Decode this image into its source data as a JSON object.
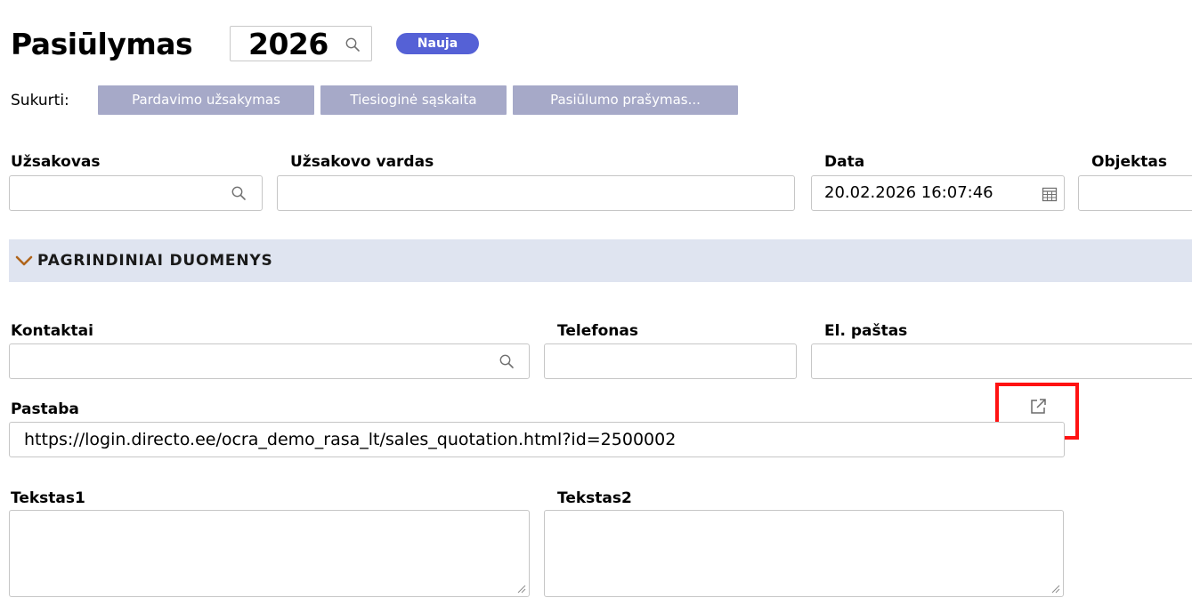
{
  "header": {
    "title": "Pasiūlymas",
    "number": "2026",
    "status": "Nauja"
  },
  "create": {
    "label": "Sukurti:",
    "buttons": [
      "Pardavimo užsakymas",
      "Tiesioginė sąskaita",
      "Pasiūlumo prašymas..."
    ]
  },
  "fields": {
    "customer_label": "Užsakovas",
    "customer_value": "",
    "customer_name_label": "Užsakovo vardas",
    "customer_name_value": "",
    "date_label": "Data",
    "date_value": "20.02.2026 16:07:46",
    "object_label": "Objektas",
    "object_value": ""
  },
  "section": {
    "title": "PAGRINDINIAI DUOMENYS"
  },
  "main": {
    "contacts_label": "Kontaktai",
    "contacts_value": "",
    "phone_label": "Telefonas",
    "phone_value": "",
    "email_label": "El. paštas",
    "email_value": "",
    "note_label": "Pastaba",
    "note_value": "https://login.directo.ee/ocra_demo_rasa_lt/sales_quotation.html?id=2500002",
    "text1_label": "Tekstas1",
    "text1_value": "",
    "text2_label": "Tekstas2",
    "text2_value": ""
  },
  "colors": {
    "status_badge": "#5561d6",
    "create_button": "#a6a9c8",
    "section_bg": "#dfe4f0",
    "chevron": "#b0651c",
    "highlight": "#ff1212"
  },
  "icons": {
    "search": "search-icon",
    "calendar": "calendar-icon",
    "chevron": "chevron-down-icon",
    "external_link": "external-link-icon"
  }
}
